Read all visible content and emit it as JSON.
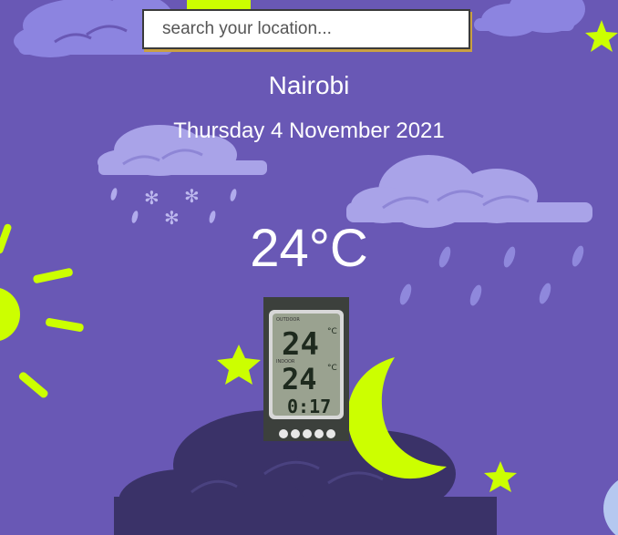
{
  "search": {
    "placeholder": "search your location...",
    "value": ""
  },
  "location": {
    "city": "Nairobi",
    "date": "Thursday 4 November 2021"
  },
  "weather": {
    "temperature": "24°C",
    "thermometer": {
      "outdoor_reading": "24",
      "indoor_reading": "24",
      "clock": "0:17",
      "label_outdoor": "OUTDOOR",
      "label_indoor": "INDOOR"
    }
  },
  "theme": {
    "background": "#6958b5",
    "accent_yellow": "#ccff00",
    "cloud_light": "#a9a3e8",
    "cloud_dark": "#3a3268",
    "rain": "#8f88dc"
  }
}
